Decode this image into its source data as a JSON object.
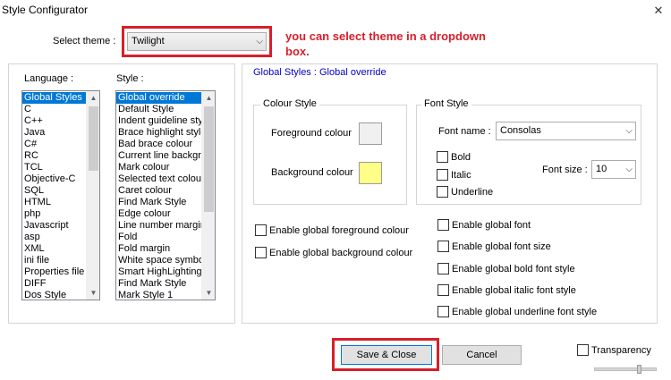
{
  "window": {
    "title": "Style Configurator",
    "close_glyph": "✕"
  },
  "theme": {
    "label": "Select theme :",
    "value": "Twilight",
    "arrow": "⌵"
  },
  "annotations": {
    "theme_note_line1": "you can select theme in a dropdown",
    "theme_note_line2": "box."
  },
  "language": {
    "label": "Language :",
    "items": [
      "Global Styles",
      "C",
      "C++",
      "Java",
      "C#",
      "RC",
      "TCL",
      "Objective-C",
      "SQL",
      "HTML",
      "php",
      "Javascript",
      "asp",
      "XML",
      "ini file",
      "Properties file",
      "DIFF",
      "Dos Style"
    ],
    "selected_index": 0
  },
  "style": {
    "label": "Style :",
    "items": [
      "Global override",
      "Default Style",
      "Indent guideline sty",
      "Brace highlight style",
      "Bad brace colour",
      "Current line backgr",
      "Mark colour",
      "Selected text colou",
      "Caret colour",
      "Find Mark Style",
      "Edge colour",
      "Line number margin",
      "Fold",
      "Fold margin",
      "White space symbo",
      "Smart HighLighting",
      "Find Mark Style",
      "Mark Style 1"
    ],
    "selected_index": 0
  },
  "scroll": {
    "up": "▲",
    "down": "▼"
  },
  "heading": "Global Styles : Global override",
  "colour_style": {
    "title": "Colour Style",
    "foreground_label": "Foreground colour",
    "background_label": "Background colour",
    "foreground_color": "#f0f0f0",
    "background_color": "#ffff88"
  },
  "font_style": {
    "title": "Font Style",
    "font_name_label": "Font name :",
    "font_name_value": "Consolas",
    "bold": "Bold",
    "italic": "Italic",
    "underline": "Underline",
    "font_size_label": "Font size :",
    "font_size_value": "10"
  },
  "global_checks_left": [
    "Enable global foreground colour",
    "Enable global background colour"
  ],
  "global_checks_right": [
    "Enable global font",
    "Enable global font size",
    "Enable global bold font style",
    "Enable global italic font style",
    "Enable global underline font style"
  ],
  "buttons": {
    "save_close": "Save & Close",
    "cancel": "Cancel"
  },
  "transparency": {
    "label": "Transparency"
  },
  "colors": {
    "annotation": "#d81e2a",
    "selection": "#0078d7",
    "heading": "#0000c8"
  }
}
